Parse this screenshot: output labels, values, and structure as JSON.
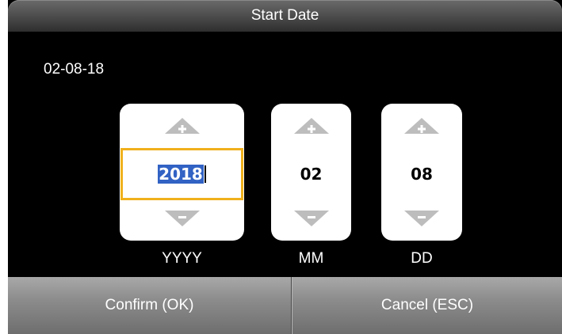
{
  "header": {
    "title": "Start Date"
  },
  "current_date": "02-08-18",
  "fields": [
    {
      "value": "2018",
      "label": "YYYY",
      "focused": true
    },
    {
      "value": "02",
      "label": "MM",
      "focused": false
    },
    {
      "value": "08",
      "label": "DD",
      "focused": false
    }
  ],
  "footer": {
    "confirm_label": "Confirm (OK)",
    "cancel_label": "Cancel (ESC)"
  },
  "colors": {
    "focus_border": "#f0b01c",
    "selection": "#3162c4",
    "arrow": "#bdbdbd"
  },
  "icons": {
    "increment": "plus-icon",
    "decrement": "minus-icon"
  }
}
